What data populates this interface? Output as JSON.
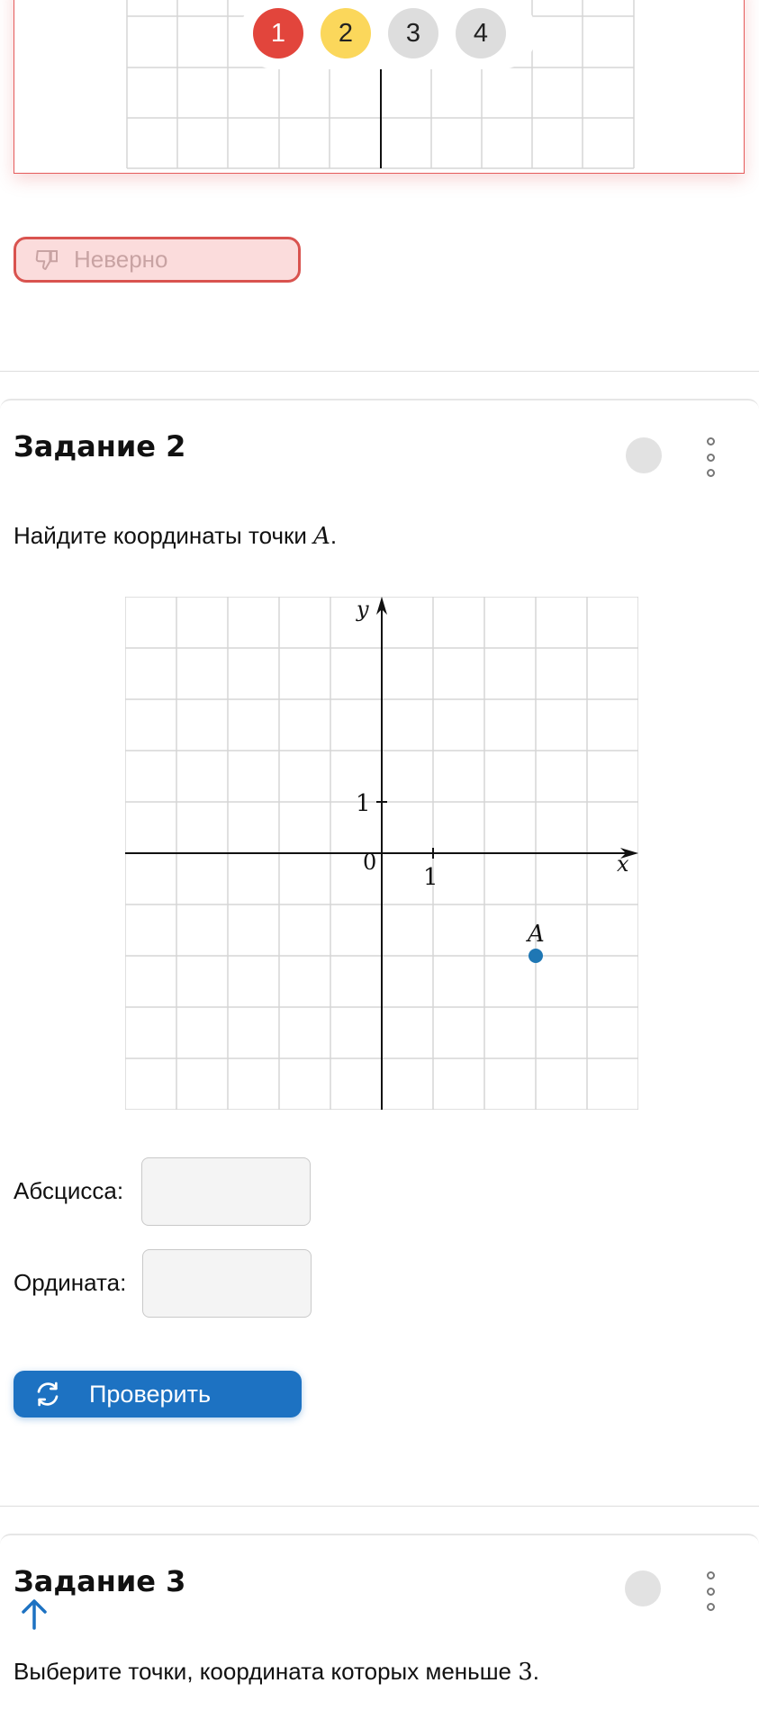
{
  "prev_task": {
    "pages": [
      {
        "label": "1",
        "color": "#e2453c",
        "text_color": "#ffffff"
      },
      {
        "label": "2",
        "color": "#fbd75b",
        "text_color": "#222222"
      },
      {
        "label": "3",
        "color": "#dddddd",
        "text_color": "#222222"
      },
      {
        "label": "4",
        "color": "#dddddd",
        "text_color": "#222222"
      }
    ],
    "result_label": "Неверно"
  },
  "task2": {
    "title": "Задание 2",
    "prompt_text": "Найдите координаты точки ",
    "prompt_var": "A",
    "prompt_end": ".",
    "graph": {
      "x_axis_label": "x",
      "y_axis_label": "y",
      "origin_label": "0",
      "x_unit_label": "1",
      "y_unit_label": "1",
      "x_range": [
        -5,
        5
      ],
      "y_range": [
        -5,
        5
      ],
      "point": {
        "name": "A",
        "x": 3,
        "y": -2,
        "color": "#1f77b4"
      }
    },
    "abscissa_label": "Абсцисса:",
    "abscissa_value": "",
    "ordinate_label": "Ордината:",
    "ordinate_value": "",
    "check_label": "Проверить"
  },
  "task3": {
    "title": "Задание 3",
    "prompt_text": "Выберите точки, координата которых меньше ",
    "prompt_num": "3",
    "prompt_end": "."
  },
  "colors": {
    "accent": "#1d72c2",
    "error": "#d9534f",
    "point": "#1f77b4"
  }
}
